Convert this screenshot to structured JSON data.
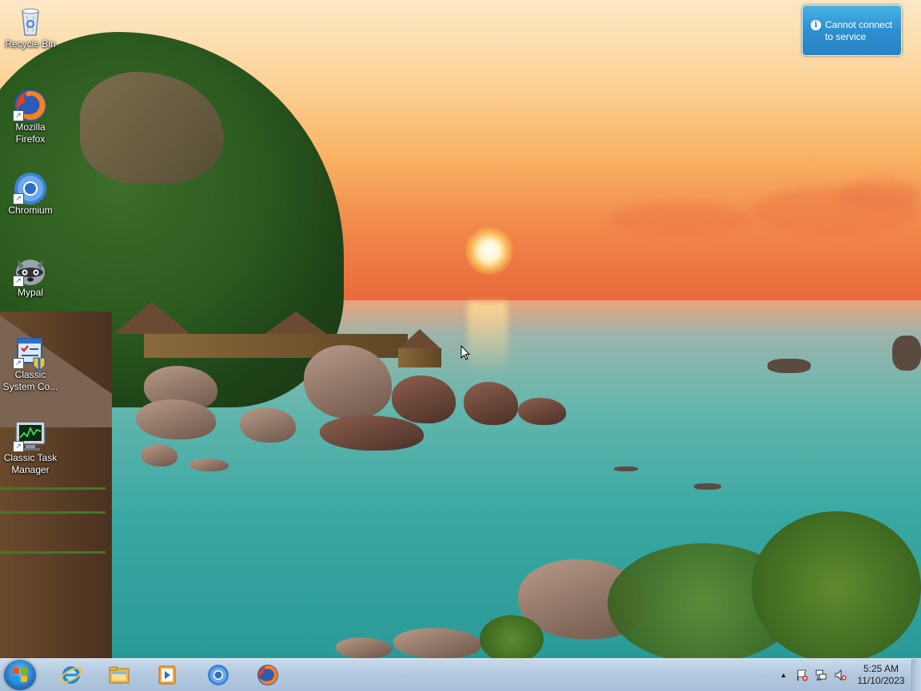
{
  "desktop": {
    "icons": [
      {
        "label": "Recycle Bin",
        "icon": "recycle-bin-icon"
      },
      {
        "label": "Mozilla Firefox",
        "icon": "firefox-icon"
      },
      {
        "label": "Chromium",
        "icon": "chromium-icon"
      },
      {
        "label": "Mypal",
        "icon": "mypal-icon"
      },
      {
        "label": "Classic System Co...",
        "icon": "classic-system-control-icon"
      },
      {
        "label": "Classic Task Manager",
        "icon": "task-manager-icon"
      }
    ]
  },
  "notification": {
    "icon": "info-icon",
    "text": "Cannot connect to service"
  },
  "taskbar": {
    "start": "start-button",
    "pinned": [
      {
        "name": "Internet Explorer",
        "icon": "ie-icon"
      },
      {
        "name": "Windows Explorer",
        "icon": "folder-icon"
      },
      {
        "name": "Windows Media Player",
        "icon": "media-player-icon"
      },
      {
        "name": "Chromium",
        "icon": "chromium-icon"
      },
      {
        "name": "Mozilla Firefox",
        "icon": "firefox-icon"
      }
    ],
    "tray": {
      "icons": [
        "show-hidden-icons-chevron",
        "action-center-flag-icon",
        "network-icon",
        "volume-muted-icon"
      ],
      "time": "5:25 AM",
      "date": "11/10/2023"
    }
  },
  "colors": {
    "taskbar": "#b2c8df",
    "notification": "#2d8fd0",
    "sky_top": "#fde8c6",
    "sea": "#3aa8a2"
  }
}
